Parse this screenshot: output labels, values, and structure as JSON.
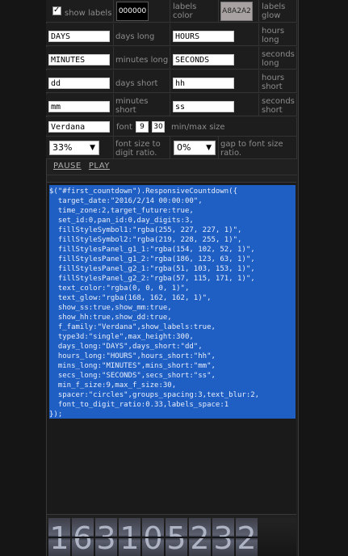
{
  "settings": {
    "show_labels_label": "show labels",
    "labels_color_value": "000000",
    "labels_color_label": "labels color",
    "labels_glow_value": "A8A2A2",
    "labels_glow_label": "labels glow",
    "days_long_value": "DAYS",
    "days_long_label": "days long",
    "hours_long_value": "HOURS",
    "hours_long_label": "hours long",
    "minutes_long_value": "MINUTES",
    "minutes_long_label": "minutes long",
    "seconds_long_value": "SECONDS",
    "seconds_long_label": "seconds long",
    "days_short_value": "dd",
    "days_short_label": "days short",
    "hours_short_value": "hh",
    "hours_short_label": "hours short",
    "minutes_short_value": "mm",
    "minutes_short_label": "minutes short",
    "seconds_short_value": "ss",
    "seconds_short_label": "seconds short",
    "font_value": "Verdana",
    "font_label": "font",
    "font_min": "9",
    "font_max": "30",
    "minmax_label": "min/max size",
    "ratio_value": "33%",
    "ratio_label": "font size to digit ratio.",
    "gap_value": "0%",
    "gap_label": "gap to font size ratio."
  },
  "controls": {
    "pause": "PAUSE",
    "play": "PLAY"
  },
  "code_lines": [
    "$(\"#first_countdown\").ResponsiveCountdown({",
    "  target_date:\"2016/2/14 00:00:00\",",
    "  time_zone:2,target_future:true,",
    "  set_id:0,pan_id:0,day_digits:3,",
    "  fillStyleSymbol1:\"rgba(255, 227, 227, 1)\",",
    "  fillStyleSymbol2:\"rgba(219, 228, 255, 1)\",",
    "  fillStylesPanel_g1_1:\"rgba(154, 102, 52, 1)\",",
    "  fillStylesPanel_g1_2:\"rgba(186, 123, 63, 1)\",",
    "  fillStylesPanel_g2_1:\"rgba(51, 103, 153, 1)\",",
    "  fillStylesPanel_g2_2:\"rgba(57, 115, 171, 1)\",",
    "  text_color:\"rgba(0, 0, 0, 1)\",",
    "  text_glow:\"rgba(168, 162, 162, 1)\",",
    "  show_ss:true,show_mm:true,",
    "  show_hh:true,show_dd:true,",
    "  f_family:\"Verdana\",show_labels:true,",
    "  type3d:\"single\",max_height:300,",
    "  days_long:\"DAYS\",days_short:\"dd\",",
    "  hours_long:\"HOURS\",hours_short:\"hh\",",
    "  mins_long:\"MINUTES\",mins_short:\"mm\",",
    "  secs_long:\"SECONDS\",secs_short:\"ss\",",
    "  min_f_size:9,max_f_size:30,",
    "  spacer:\"circles\",groups_spacing:3,text_blur:2,",
    "  font_to_digit_ratio:0.33,labels_space:1",
    "});"
  ],
  "countdown_digits": [
    "1",
    "6",
    "3",
    "1",
    "0",
    "5",
    "2",
    "3",
    "2"
  ],
  "colors": {
    "selection": "#1f5fc4",
    "labels_color": "#000000",
    "labels_glow": "#A8A2A2"
  }
}
